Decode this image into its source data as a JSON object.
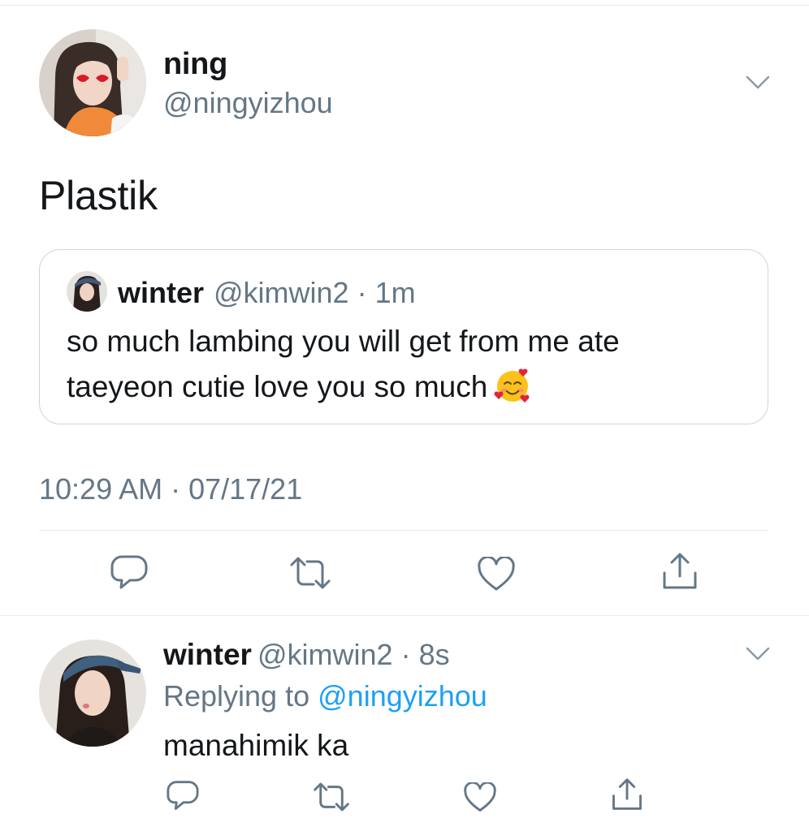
{
  "main_tweet": {
    "author_name": "ning",
    "author_handle": "@ningyizhou",
    "text": "Plastik",
    "timestamp": "10:29 AM · 07/17/21",
    "quoted": {
      "author_name": "winter",
      "meta": "@kimwin2 · 1m",
      "text_line1": "so much lambing you will get from me ate",
      "text_line2": "taeyeon cutie love you so much",
      "emoji": "smiling-face-with-hearts"
    },
    "actions": [
      "reply-icon",
      "retweet-icon",
      "like-icon",
      "share-icon"
    ]
  },
  "reply": {
    "author_name": "winter",
    "meta": "@kimwin2 · 8s",
    "replying_prefix": "Replying to",
    "replying_handle": "@ningyizhou",
    "text": "manahimik ka",
    "actions": [
      "reply-icon",
      "retweet-icon",
      "like-icon",
      "share-icon"
    ]
  },
  "colors": {
    "text": "#14171a",
    "secondary": "#657786",
    "link": "#1da1f2",
    "border": "#ccd6dd",
    "icon": "#657786"
  }
}
